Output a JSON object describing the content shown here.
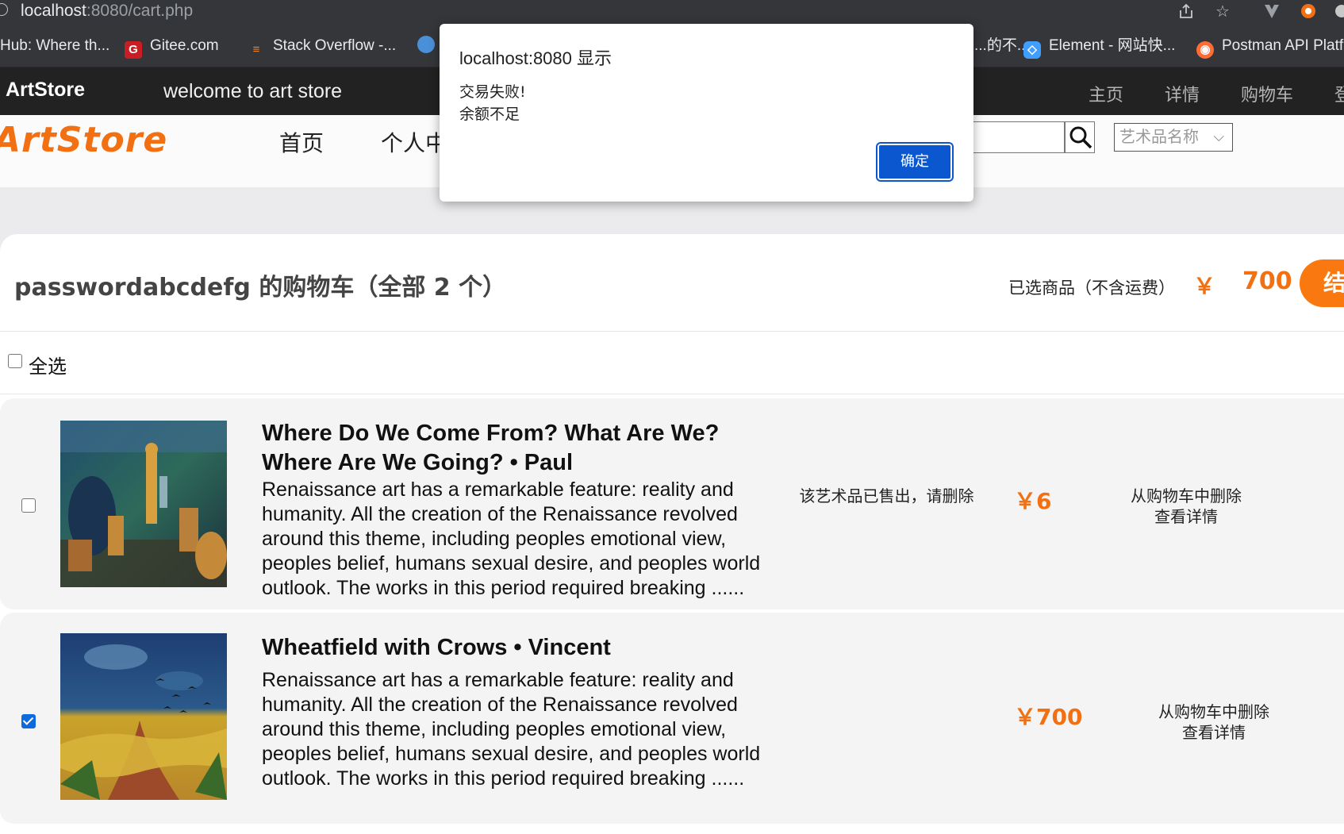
{
  "browser": {
    "url_host": "localhost",
    "url_rest": ":8080/cart.php",
    "bookmarks": [
      {
        "label": "Hub: Where th...",
        "icon": "github-icon"
      },
      {
        "label": "Gitee.com",
        "icon": "gitee-icon"
      },
      {
        "label": "Stack Overflow -...",
        "icon": "stackoverflow-icon"
      },
      {
        "label": "...的不...",
        "icon": "bookmark-icon"
      },
      {
        "label": "Element - 网站快...",
        "icon": "element-icon"
      },
      {
        "label": "Postman API Platf",
        "icon": "postman-icon"
      }
    ]
  },
  "site_nav": {
    "brand": "ArtStore",
    "welcome": "welcome to art store",
    "links": [
      "主页",
      "详情",
      "购物车",
      "登"
    ]
  },
  "header": {
    "logo": "ArtStore",
    "menu": [
      "首页",
      "个人中"
    ],
    "search_placeholder": "",
    "select_value": "艺术品名称"
  },
  "cart": {
    "title": "passwordabcdefg 的购物车（全部 2 个）",
    "selected_label": "已选商品（不含运费）",
    "currency": "￥",
    "total": "700",
    "checkout_label": "结算",
    "select_all_label": "全选",
    "select_all_checked": false,
    "items": [
      {
        "checked": false,
        "title": "Where Do We Come From? What Are We? Where Are We Going? • Paul",
        "desc": "Renaissance art has a remarkable feature: reality and humanity. All the creation of the Renaissance revolved around this theme, including peoples emotional view, peoples belief, humans sexual desire, and peoples world outlook. The works in this period required breaking ......",
        "status": "该艺术品已售出，请删除",
        "price": "￥6",
        "action_delete": "从购物车中删除",
        "action_detail": "查看详情"
      },
      {
        "checked": true,
        "title": "Wheatfield with Crows • Vincent",
        "desc": "Renaissance art has a remarkable feature: reality and humanity. All the creation of the Renaissance revolved around this theme, including peoples emotional view, peoples belief, humans sexual desire, and peoples world outlook. The works in this period required breaking ......",
        "status": "",
        "price": "￥700",
        "action_delete": "从购物车中删除",
        "action_detail": "查看详情"
      }
    ]
  },
  "dialog": {
    "title": "localhost:8080 显示",
    "line1": "交易失败!",
    "line2": "余额不足",
    "ok_label": "确定"
  },
  "colors": {
    "accent": "#f26f12",
    "checkout": "#f9780f",
    "dialog_button": "#0b57d0",
    "nav_bg": "#222222",
    "chrome_bg": "#35363a"
  }
}
